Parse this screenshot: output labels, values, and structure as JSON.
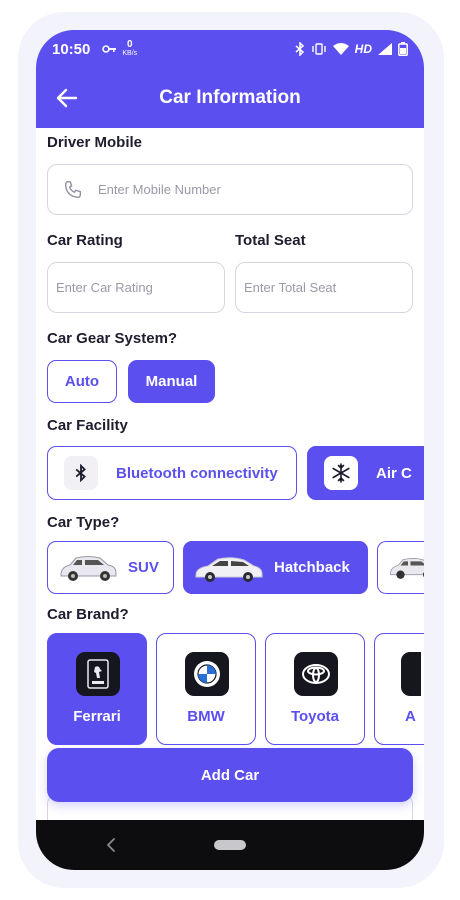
{
  "status_bar": {
    "time": "10:50",
    "data_rate_value": "0",
    "data_rate_unit": "KB/s",
    "network": "HD"
  },
  "app_bar": {
    "title": "Car Information"
  },
  "driver_mobile": {
    "label": "Driver Mobile",
    "placeholder": "Enter Mobile Number"
  },
  "car_rating": {
    "label": "Car Rating",
    "placeholder": "Enter Car Rating"
  },
  "total_seat": {
    "label": "Total Seat",
    "placeholder": "Enter Total Seat"
  },
  "gear_system": {
    "label": "Car Gear System?",
    "options": [
      "Auto",
      "Manual"
    ],
    "selected": "Manual"
  },
  "facility": {
    "label": "Car Facility",
    "options": [
      "Bluetooth connectivity",
      "Air C"
    ],
    "selected": "Air C"
  },
  "car_type": {
    "label": "Car Type?",
    "options": [
      "SUV",
      "Hatchback"
    ],
    "selected": "Hatchback"
  },
  "car_brand": {
    "label": "Car Brand?",
    "options": [
      "Ferrari",
      "BMW",
      "Toyota",
      "A"
    ],
    "selected": "Ferrari"
  },
  "add_button": {
    "label": "Add Car"
  },
  "colors": {
    "accent": "#5b4ff0",
    "text": "#1e1e2e",
    "placeholder": "#9a9aa8",
    "border": "#d6d6e2"
  }
}
